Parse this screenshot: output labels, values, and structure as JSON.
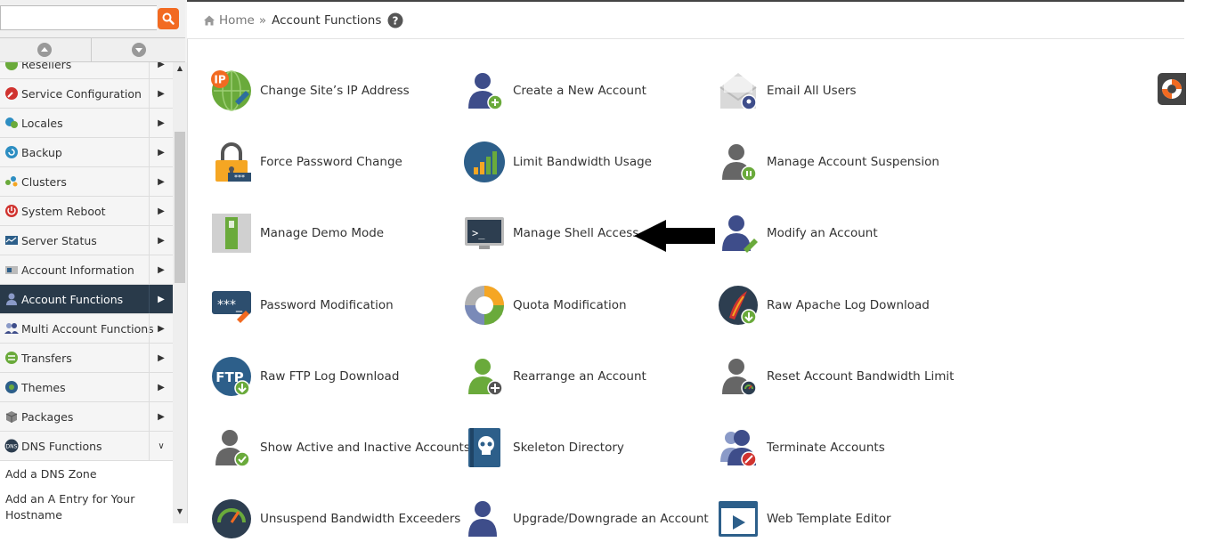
{
  "search": {
    "placeholder": "",
    "value": ""
  },
  "sidebar": {
    "items": [
      {
        "label": "Resellers",
        "icon": "reseller-icon",
        "arrow": "▶"
      },
      {
        "label": "Service Configuration",
        "icon": "wrench-icon",
        "arrow": "▶"
      },
      {
        "label": "Locales",
        "icon": "locale-icon",
        "arrow": "▶"
      },
      {
        "label": "Backup",
        "icon": "backup-icon",
        "arrow": "▶"
      },
      {
        "label": "Clusters",
        "icon": "cluster-icon",
        "arrow": "▶"
      },
      {
        "label": "System Reboot",
        "icon": "power-icon",
        "arrow": "▶"
      },
      {
        "label": "Server Status",
        "icon": "server-status-icon",
        "arrow": "▶"
      },
      {
        "label": "Account Information",
        "icon": "account-info-icon",
        "arrow": "▶"
      },
      {
        "label": "Account Functions",
        "icon": "account-functions-icon",
        "arrow": "▶",
        "active": true
      },
      {
        "label": "Multi Account Functions",
        "icon": "multi-account-icon",
        "arrow": "▶"
      },
      {
        "label": "Transfers",
        "icon": "transfers-icon",
        "arrow": "▶"
      },
      {
        "label": "Themes",
        "icon": "themes-icon",
        "arrow": "▶"
      },
      {
        "label": "Packages",
        "icon": "packages-icon",
        "arrow": "▶"
      },
      {
        "label": "DNS Functions",
        "icon": "dns-icon",
        "arrow": "∨"
      }
    ],
    "sub_items": [
      "Add a DNS Zone",
      "Add an A Entry for Your Hostname"
    ]
  },
  "breadcrumb": {
    "home": "Home",
    "separator": "»",
    "current": "Account Functions"
  },
  "tiles": [
    {
      "label": "Change Site’s IP Address",
      "icon": "change-ip-icon"
    },
    {
      "label": "Create a New Account",
      "icon": "create-account-icon"
    },
    {
      "label": "Email All Users",
      "icon": "email-users-icon"
    },
    {
      "label": "Force Password Change",
      "icon": "force-password-icon"
    },
    {
      "label": "Limit Bandwidth Usage",
      "icon": "limit-bandwidth-icon"
    },
    {
      "label": "Manage Account Suspension",
      "icon": "account-suspension-icon"
    },
    {
      "label": "Manage Demo Mode",
      "icon": "demo-mode-icon"
    },
    {
      "label": "Manage Shell Access",
      "icon": "shell-access-icon"
    },
    {
      "label": "Modify an Account",
      "icon": "modify-account-icon"
    },
    {
      "label": "Password Modification",
      "icon": "password-modification-icon"
    },
    {
      "label": "Quota Modification",
      "icon": "quota-icon"
    },
    {
      "label": "Raw Apache Log Download",
      "icon": "apache-log-icon"
    },
    {
      "label": "Raw FTP Log Download",
      "icon": "ftp-log-icon"
    },
    {
      "label": "Rearrange an Account",
      "icon": "rearrange-account-icon"
    },
    {
      "label": "Reset Account Bandwidth Limit",
      "icon": "reset-bandwidth-icon"
    },
    {
      "label": "Show Active and Inactive Accounts",
      "icon": "active-accounts-icon"
    },
    {
      "label": "Skeleton Directory",
      "icon": "skeleton-icon"
    },
    {
      "label": "Terminate Accounts",
      "icon": "terminate-accounts-icon"
    },
    {
      "label": "Unsuspend Bandwidth Exceeders",
      "icon": "unsuspend-bandwidth-icon"
    },
    {
      "label": "Upgrade/Downgrade an Account",
      "icon": "upgrade-account-icon"
    },
    {
      "label": "Web Template Editor",
      "icon": "web-template-icon"
    }
  ],
  "colors": {
    "sidebar_active": "#293a4a",
    "search_button": "#f26a21",
    "user_icon": "#3e4d8a",
    "user_icon_grey": "#666666",
    "green": "#6aaa3b"
  }
}
